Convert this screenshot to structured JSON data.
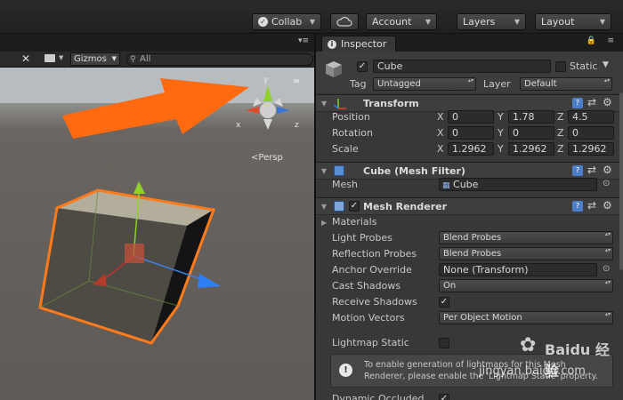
{
  "toolbar": {
    "collab_label": "Collab",
    "cloud_icon": "cloud-icon",
    "account_label": "Account",
    "layers_label": "Layers",
    "layout_label": "Layout"
  },
  "scene": {
    "gizmos_label": "Gizmos",
    "search_placeholder": "’All",
    "search_value": "All",
    "persp_label": "Persp",
    "axis_x": "x",
    "axis_y": "y",
    "axis_z": "z"
  },
  "inspector": {
    "tab_label": "Inspector",
    "object_name": "Cube",
    "static_label": "Static",
    "tag_label": "Tag",
    "tag_value": "Untagged",
    "layer_label": "Layer",
    "layer_value": "Default",
    "transform": {
      "title": "Transform",
      "position_label": "Position",
      "rotation_label": "Rotation",
      "scale_label": "Scale",
      "position": {
        "x": "0",
        "y": "1.78",
        "z": "4.5"
      },
      "rotation": {
        "x": "0",
        "y": "0",
        "z": "0"
      },
      "scale": {
        "x": "1.2962",
        "y": "1.2962",
        "z": "1.2962"
      }
    },
    "mesh_filter": {
      "title": "Cube (Mesh Filter)",
      "mesh_label": "Mesh",
      "mesh_value": "Cube"
    },
    "mesh_renderer": {
      "title": "Mesh Renderer",
      "materials_label": "Materials",
      "light_probes_label": "Light Probes",
      "light_probes_value": "Blend Probes",
      "reflection_probes_label": "Reflection Probes",
      "reflection_probes_value": "Blend Probes",
      "anchor_override_label": "Anchor Override",
      "anchor_override_value": "None (Transform)",
      "cast_shadows_label": "Cast Shadows",
      "cast_shadows_value": "On",
      "receive_shadows_label": "Receive Shadows",
      "motion_vectors_label": "Motion Vectors",
      "motion_vectors_value": "Per Object Motion",
      "lightmap_static_label": "Lightmap Static",
      "info_line1": "To enable generation of lightmaps for this Mesh",
      "info_line2": "Renderer, please enable the 'Lightmap Static' property.",
      "dynamic_occluded_label": "Dynamic Occluded"
    }
  },
  "watermark": {
    "line1": "Baidu 经验",
    "line2": "jingyan.baidu.com"
  },
  "colors": {
    "accent_orange": "#ff6a10",
    "panel_bg": "#383838",
    "field_bg": "#2c2c2c"
  }
}
